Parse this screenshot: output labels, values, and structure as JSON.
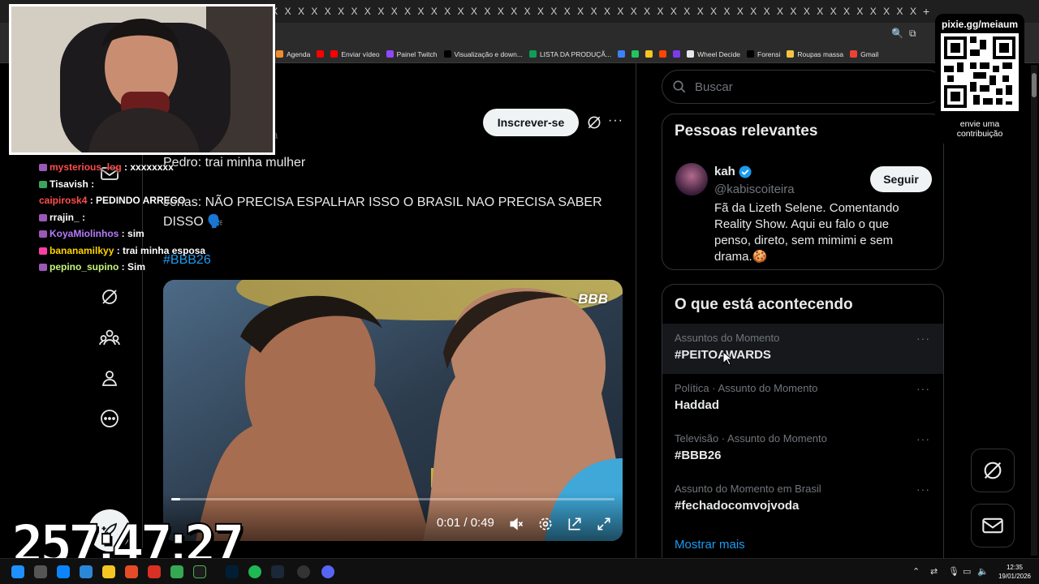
{
  "browser": {
    "tab_glyph": "X",
    "new_tab": "+",
    "bookmarks": [
      {
        "label": "Agenda",
        "color": "#f28b2f"
      },
      {
        "label": "",
        "color": "#ff0000"
      },
      {
        "label": "Enviar vídeo",
        "color": "#ff0000"
      },
      {
        "label": "Painel Twitch",
        "color": "#9146ff"
      },
      {
        "label": "Visualização e down...",
        "color": "#000000"
      },
      {
        "label": "LISTA DA PRODUÇÃ...",
        "color": "#0f9d58"
      },
      {
        "label": "",
        "color": "#3b82f6"
      },
      {
        "label": "",
        "color": "#22c55e"
      },
      {
        "label": "",
        "color": "#f7c325"
      },
      {
        "label": "",
        "color": "#ff4500"
      },
      {
        "label": "",
        "color": "#7c3aed"
      },
      {
        "label": "Wheel Decide",
        "color": "#e5e7eb"
      },
      {
        "label": "Forensi",
        "color": "#000000"
      },
      {
        "label": "Roupas massa",
        "color": "#f5c542"
      },
      {
        "label": "Gmail",
        "color": "#ea4335"
      }
    ]
  },
  "post": {
    "subscribe_label": "Inscrever-se",
    "author_partial": "ra",
    "line1": "Pedro: trai minha mulher",
    "line2a": "Jonas: NÃO PRECISA ESPALHAR ISSO O BRASIL NAO PRECISA SABER",
    "line2b": "DISSO 🗣️",
    "hashtag": "#BBB26",
    "video": {
      "logo": "BBB",
      "time": "0:01 / 0:49",
      "progress": 0.02
    }
  },
  "sidebar": {
    "search_placeholder": "Buscar",
    "relevant": {
      "title": "Pessoas relevantes",
      "name": "kah",
      "handle": "@kabiscoiteira",
      "bio": "Fã da Lizeth Selene. Comentando Reality Show. Aqui eu falo o que penso, direto, sem mimimi e sem drama.🍪",
      "follow_label": "Seguir"
    },
    "trends": {
      "title": "O que está acontecendo",
      "items": [
        {
          "meta": "Assuntos do Momento",
          "name": "#PEITOAWARDS"
        },
        {
          "meta": "Política · Assunto do Momento",
          "name": "Haddad"
        },
        {
          "meta": "Televisão · Assunto do Momento",
          "name": "#BBB26"
        },
        {
          "meta": "Assunto do Momento em Brasil",
          "name": "#fechadocomvojvoda"
        }
      ],
      "more_glyph": "···",
      "show_more": "Mostrar mais"
    }
  },
  "overlay": {
    "chat": [
      {
        "user": "mysterious_log",
        "user_color": "#ff4d4d",
        "text": "xxxxxxxx",
        "badge": "#9b59b6"
      },
      {
        "user": "Tisavish",
        "user_color": "#ffffff",
        "text": "",
        "badge": "#3ba55d"
      },
      {
        "user": "caipirosk4",
        "user_color": "#ff4d4d",
        "text": "PEDINDO ARREGO",
        "badge": ""
      },
      {
        "user": "rrajin_",
        "user_color": "#ffffff",
        "text": "",
        "badge": "#9b59b6"
      },
      {
        "user": "KoyaMiolinhos",
        "user_color": "#b57cff",
        "text": "sim",
        "badge": "#9b59b6"
      },
      {
        "user": "bananamilkyy",
        "user_color": "#ffd400",
        "text": "trai minha esposa",
        "badge": "#ff3ea5"
      },
      {
        "user": "pepino_supino",
        "user_color": "#c4f57a",
        "text": "Sim",
        "badge": "#9b59b6"
      }
    ],
    "qr_title": "pixie.gg/meiaum",
    "qr_caption_1": "envie uma",
    "qr_caption_2": "contribuição",
    "timer": "257:47:27"
  },
  "taskbar": {
    "clock_time": "12:35",
    "clock_date": "19/01/2026"
  }
}
